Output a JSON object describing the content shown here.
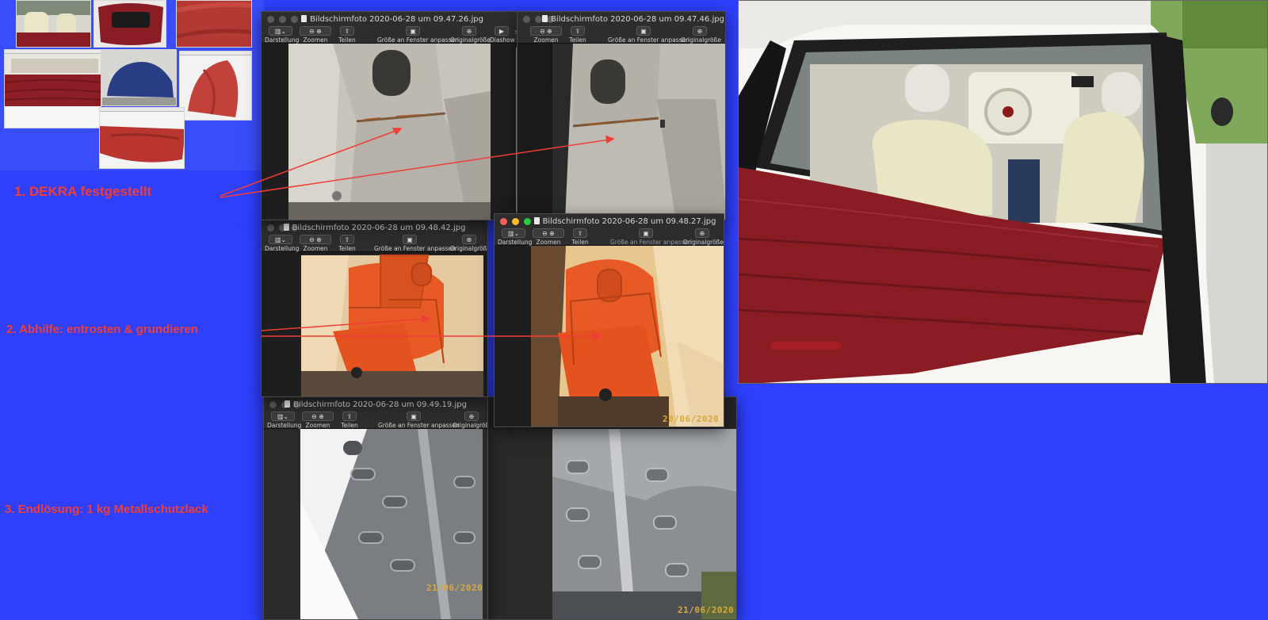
{
  "annotations": {
    "step1": "1.  DEKRA   festgestellt",
    "step2": "2.  Abhilfe: entrosten & grundieren",
    "step3": "3. Endlösung:  1 kg Metallschutzlack"
  },
  "toolbar": {
    "view": "Darstellung",
    "zoom": "Zoomen",
    "share": "Teilen",
    "fit": "Größe an Fenster anpassen",
    "actual": "Originalgröße",
    "slideshow": "Diashow",
    "more": ">>"
  },
  "windows": {
    "w1": {
      "title": "Bildschirmfoto 2020-06-28 um 09.47.26.jpg"
    },
    "w2": {
      "title": "Bildschirmfoto 2020-06-28 um 09.47.46.jpg"
    },
    "w3": {
      "title": "Bildschirmfoto 2020-06-28 um 09.48.42.jpg"
    },
    "w4": {
      "title": "Bildschirmfoto 2020-06-28 um 09.48.27.jpg",
      "date": "20/06/2020"
    },
    "w5": {
      "title": "Bildschirmfoto 2020-06-28 um 09.49.19.jpg",
      "date": "21/06/2020"
    },
    "w6": {
      "date": "21/06/2020"
    }
  },
  "colors": {
    "desktop": "#2f3ffb",
    "annotation": "#ee3e35",
    "window_bg": "#252525",
    "rust_primer": "#e85a25",
    "soft_top": "#8a1d24"
  }
}
